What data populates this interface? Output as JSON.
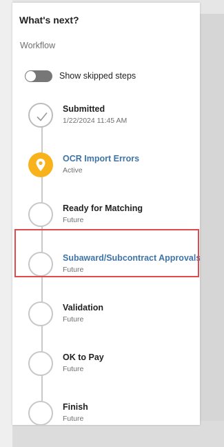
{
  "panel": {
    "title": "What's next?",
    "section_label": "Workflow",
    "toggle": {
      "label": "Show skipped steps",
      "checked": false
    }
  },
  "steps": [
    {
      "name": "Submitted",
      "status": "1/22/2024 11:45 AM",
      "state": "done",
      "icon": "check-icon"
    },
    {
      "name": "OCR Import Errors",
      "status": "Active",
      "state": "active",
      "icon": "location-pin-icon"
    },
    {
      "name": "Ready for Matching",
      "status": "Future",
      "state": "future"
    },
    {
      "name": "Subaward/Subcontract Approvals",
      "status": "Future",
      "state": "future",
      "highlighted": true
    },
    {
      "name": "Validation",
      "status": "Future",
      "state": "future"
    },
    {
      "name": "OK to Pay",
      "status": "Future",
      "state": "future"
    },
    {
      "name": "Finish",
      "status": "Future",
      "state": "future"
    }
  ],
  "colors": {
    "active": "#f7b21c",
    "link": "#3f74a8",
    "highlight": "#e14a4a",
    "toggle_off": "#777777"
  }
}
